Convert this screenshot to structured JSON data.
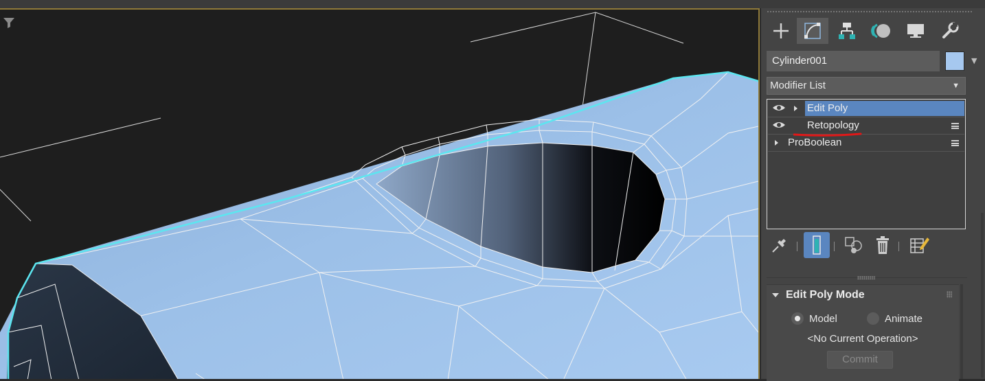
{
  "viewport": {
    "filter_icon": "filter-icon"
  },
  "command_panel": {
    "tabs": [
      {
        "name": "create",
        "icon": "plus-icon"
      },
      {
        "name": "modify",
        "icon": "modify-curve-icon",
        "active": true
      },
      {
        "name": "hierarchy",
        "icon": "hierarchy-icon"
      },
      {
        "name": "motion",
        "icon": "motion-icon"
      },
      {
        "name": "display",
        "icon": "display-monitor-icon"
      },
      {
        "name": "utilities",
        "icon": "wrench-icon"
      }
    ],
    "object_name": "Cylinder001",
    "object_color": "#a6c8ef",
    "modifier_list_label": "Modifier List",
    "stack": [
      {
        "label": "Edit Poly",
        "visible": true,
        "expandable": true,
        "selected": true
      },
      {
        "label": "Retopology",
        "visible": true,
        "expandable": false,
        "selected": false
      },
      {
        "label": "ProBoolean",
        "visible": false,
        "expandable": true,
        "selected": false
      }
    ],
    "stack_tools": [
      "pin-icon",
      "show-end-result-icon",
      "make-unique-icon",
      "remove-modifier-icon",
      "configure-sets-icon"
    ],
    "rollout": {
      "title": "Edit Poly Mode",
      "options": [
        {
          "label": "Model",
          "checked": true
        },
        {
          "label": "Animate",
          "checked": false
        }
      ],
      "current_operation": "<No Current Operation>",
      "commit_label": "Commit"
    }
  }
}
